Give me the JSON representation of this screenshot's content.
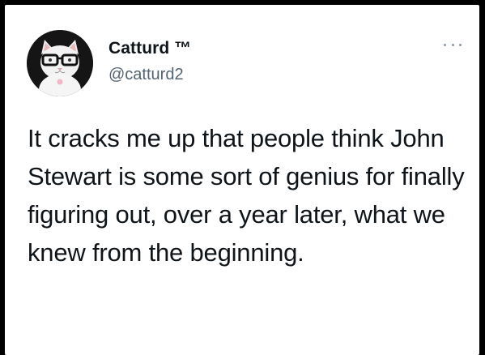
{
  "author": {
    "display_name": "Catturd ™",
    "handle": "@catturd2",
    "avatar": "cat-with-glasses-avatar"
  },
  "tweet": {
    "text": "It cracks me up that people think John Stewart is some sort of genius for finally figuring out, over a year later, what we knew from the beginning."
  },
  "icons": {
    "more": "more-horizontal-icon"
  },
  "colors": {
    "text": "#0f1419",
    "secondary": "#536471",
    "background": "#ffffff",
    "frame": "#000000"
  }
}
